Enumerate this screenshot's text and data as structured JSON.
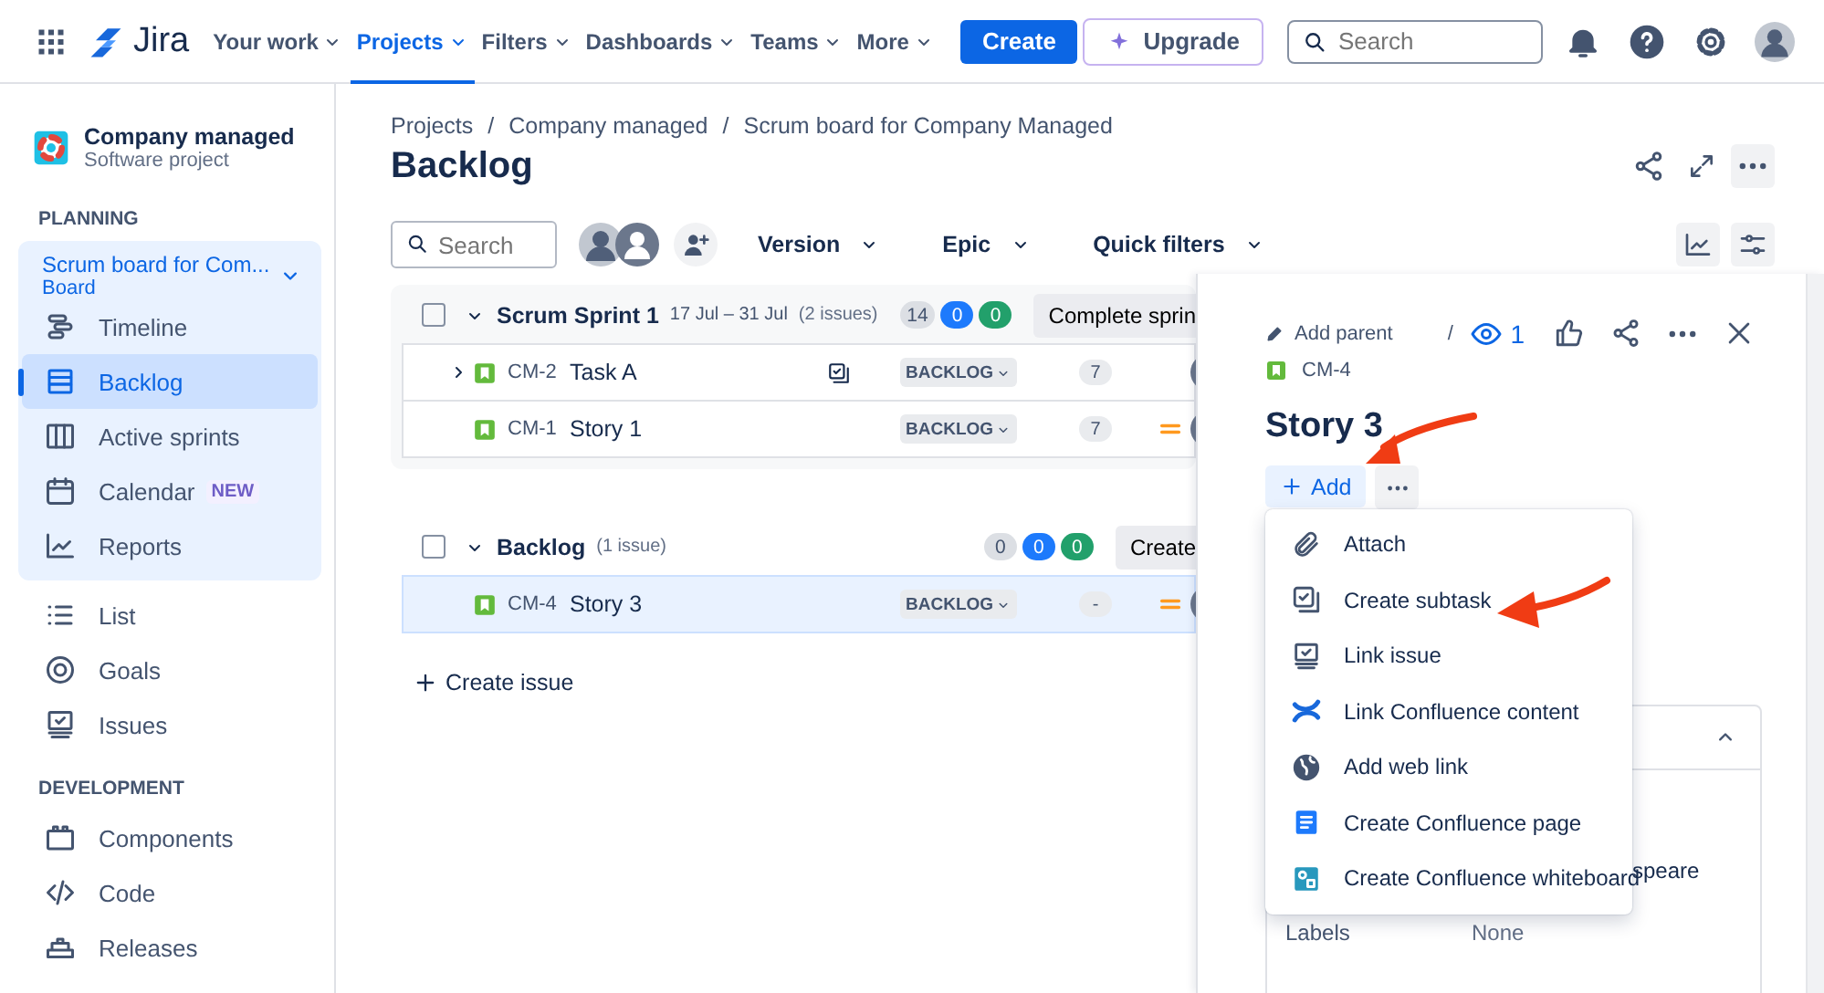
{
  "top_nav": {
    "product": "Jira",
    "items": [
      {
        "label": "Your work",
        "selected": false
      },
      {
        "label": "Projects",
        "selected": true
      },
      {
        "label": "Filters",
        "selected": false
      },
      {
        "label": "Dashboards",
        "selected": false
      },
      {
        "label": "Teams",
        "selected": false
      },
      {
        "label": "More",
        "selected": false
      }
    ],
    "create_button": "Create",
    "upgrade_button": "Upgrade",
    "search": {
      "placeholder": "Search"
    }
  },
  "sidebar": {
    "project": {
      "name": "Company managed",
      "type": "Software project"
    },
    "sections": [
      {
        "heading": "PLANNING",
        "board": {
          "name": "Scrum board for Com...",
          "subtitle": "Board",
          "expanded": true,
          "items": [
            {
              "label": "Timeline",
              "selected": false
            },
            {
              "label": "Backlog",
              "selected": true
            },
            {
              "label": "Active sprints",
              "selected": false
            },
            {
              "label": "Calendar",
              "selected": false,
              "badge": "NEW"
            },
            {
              "label": "Reports",
              "selected": false
            }
          ]
        },
        "items": [
          {
            "label": "List",
            "selected": false
          },
          {
            "label": "Goals",
            "selected": false
          },
          {
            "label": "Issues",
            "selected": false
          }
        ]
      },
      {
        "heading": "DEVELOPMENT",
        "items": [
          {
            "label": "Components",
            "selected": false
          },
          {
            "label": "Code",
            "selected": false
          },
          {
            "label": "Releases",
            "selected": false
          }
        ]
      }
    ]
  },
  "breadcrumb_separator": "/",
  "breadcrumbs": [
    "Projects",
    "Company managed",
    "Scrum board for Company Managed"
  ],
  "title": "Backlog",
  "toolbar": {
    "search": {
      "placeholder": "Search"
    },
    "filters": [
      "Version",
      "Epic",
      "Quick filters"
    ]
  },
  "sprints": [
    {
      "name": "Scrum Sprint 1",
      "dates": "17 Jul – 31 Jul",
      "count": "(2 issues)",
      "checked": false,
      "expanded": true,
      "points": [
        {
          "value": "14",
          "color": "#dcdfe4"
        },
        {
          "value": "0",
          "color": "#1d7afc"
        },
        {
          "value": "0",
          "color": "#22a06b"
        }
      ],
      "action": "Complete sprin",
      "issues": [
        {
          "key": "CM-2",
          "summary": "Task A",
          "expanded": false,
          "subtasks": true,
          "status": "BACKLOG",
          "estimate": "7",
          "has_priority": false,
          "selected": false
        },
        {
          "key": "CM-1",
          "summary": "Story 1",
          "subtasks": false,
          "status": "BACKLOG",
          "estimate": "7",
          "has_priority": true,
          "selected": false
        }
      ]
    },
    {
      "name": "Backlog",
      "count": "(1 issue)",
      "checked": false,
      "expanded": true,
      "points": [
        {
          "value": "0",
          "color": "#dcdfe4"
        },
        {
          "value": "0",
          "color": "#1d7afc"
        },
        {
          "value": "0",
          "color": "#22a06b"
        }
      ],
      "action": "Create",
      "issues": [
        {
          "key": "CM-4",
          "summary": "Story 3",
          "subtasks": false,
          "status": "BACKLOG",
          "estimate": "-",
          "has_priority": true,
          "selected": true
        }
      ]
    }
  ],
  "create_issue": "Create issue",
  "issue_panel": {
    "parent_action": "Add parent",
    "separator": "/",
    "key": "CM-4",
    "watchers": "1",
    "title": "Story 3",
    "add_button": "Add",
    "menu": [
      "Attach",
      "Create subtask",
      "Link issue",
      "Link Confluence content",
      "Add web link",
      "Create Confluence page",
      "Create Confluence whiteboard"
    ],
    "details": {
      "expanded": true,
      "partial_value": "speare",
      "fields": [
        {
          "label": "Labels",
          "value": "None"
        }
      ]
    }
  }
}
